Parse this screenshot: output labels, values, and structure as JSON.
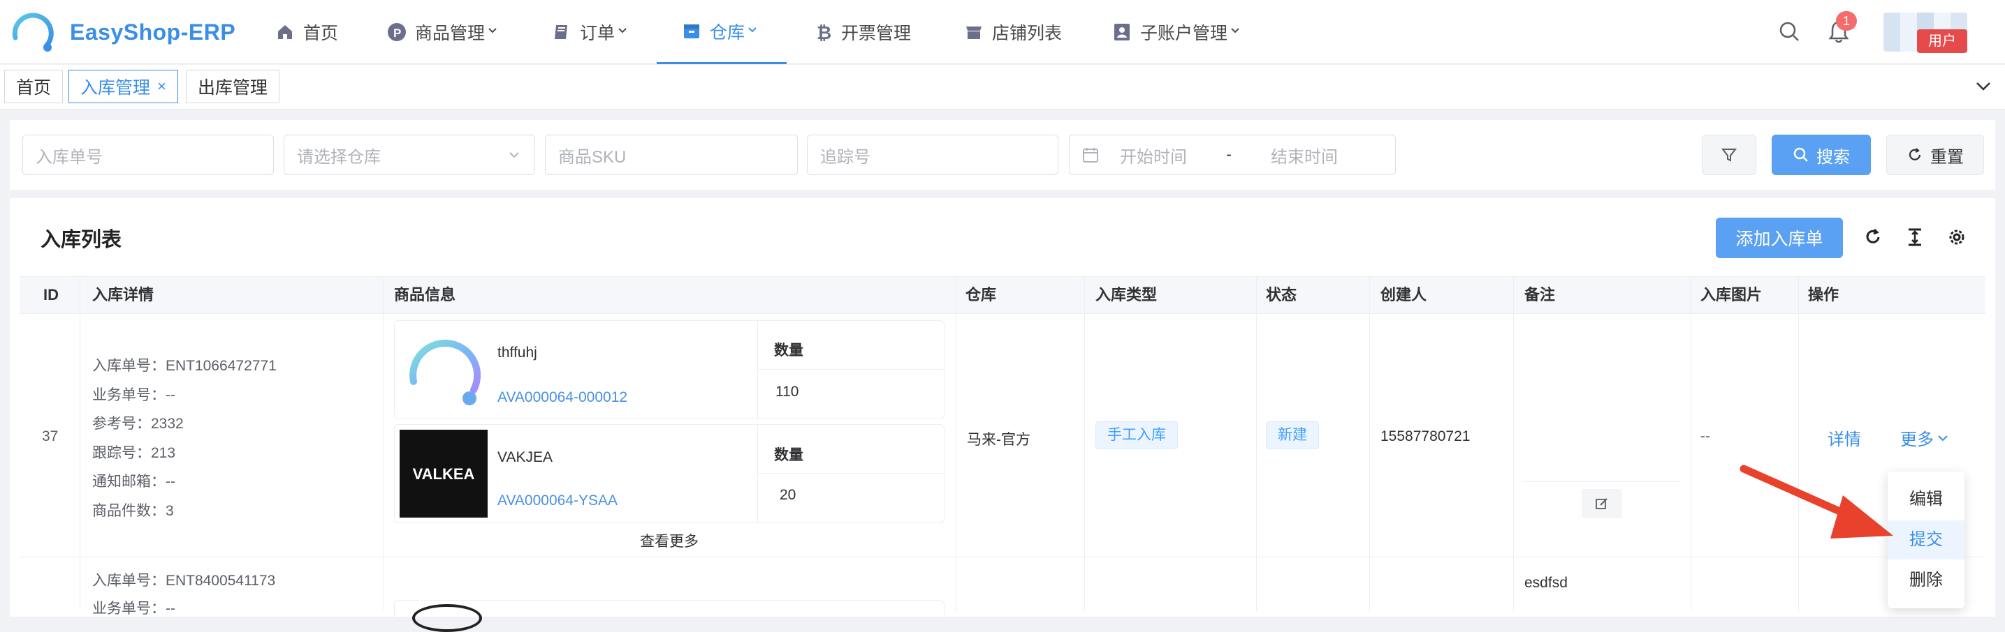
{
  "app": {
    "name": "EasyShop-ERP",
    "notification_count": "1",
    "user_label": "用户"
  },
  "nav": {
    "items": [
      {
        "label": "首页",
        "icon": "home-icon"
      },
      {
        "label": "商品管理",
        "icon": "product-p-icon",
        "dropdown": true
      },
      {
        "label": "订单",
        "icon": "book-icon",
        "dropdown": true
      },
      {
        "label": "仓库",
        "icon": "warehouse-box-icon",
        "dropdown": true,
        "active": true
      },
      {
        "label": "开票管理",
        "icon": "bitcoin-icon"
      },
      {
        "label": "店铺列表",
        "icon": "shop-icon"
      },
      {
        "label": "子账户管理",
        "icon": "sub-account-icon",
        "dropdown": true
      }
    ]
  },
  "tabs": [
    {
      "label": "首页"
    },
    {
      "label": "入库管理",
      "active": true,
      "closable": true,
      "close_glyph": "×"
    },
    {
      "label": "出库管理"
    }
  ],
  "filters": {
    "inbound_no_placeholder": "入库单号",
    "warehouse_placeholder": "请选择仓库",
    "sku_placeholder": "商品SKU",
    "tracking_placeholder": "追踪号",
    "start_placeholder": "开始时间",
    "range_separator": "-",
    "end_placeholder": "结束时间",
    "search_label": "搜索",
    "reset_label": "重置"
  },
  "list": {
    "title": "入库列表",
    "add_label": "添加入库单",
    "columns": [
      "ID",
      "入库详情",
      "商品信息",
      "仓库",
      "入库类型",
      "状态",
      "创建人",
      "备注",
      "入库图片",
      "操作"
    ],
    "rows": [
      {
        "id": "37",
        "details": [
          "入库单号：ENT1066472771",
          "业务单号：--",
          "参考号：2332",
          "跟踪号：213",
          "通知邮箱：--",
          "商品件数：3"
        ],
        "products": [
          {
            "name": "thffuhj",
            "sku": "AVA000064-000012",
            "qty_label": "数量",
            "qty": "110",
            "image": "logo"
          },
          {
            "name": "VAKJEA",
            "sku": "AVA000064-YSAA",
            "qty_label": "数量",
            "qty": "20",
            "image": "VALKEA"
          }
        ],
        "more_products": "查看更多",
        "warehouse": "马来-官方",
        "inbound_type": "手工入库",
        "status": "新建",
        "creator": "15587780721",
        "remark": "",
        "image": "--",
        "detail_link": "详情",
        "more_link": "更多"
      },
      {
        "details": [
          "入库单号：ENT8400541173",
          "业务单号：--"
        ],
        "remark": "esdfsd"
      }
    ]
  },
  "dropdown_menu": {
    "items": [
      "编辑",
      "提交",
      "删除"
    ],
    "hovered": "提交"
  },
  "colors": {
    "primary": "#3a8ee6",
    "button_blue": "#5aa1f3",
    "arrow_red": "#e8412c",
    "badge_red": "#f56c6c"
  }
}
